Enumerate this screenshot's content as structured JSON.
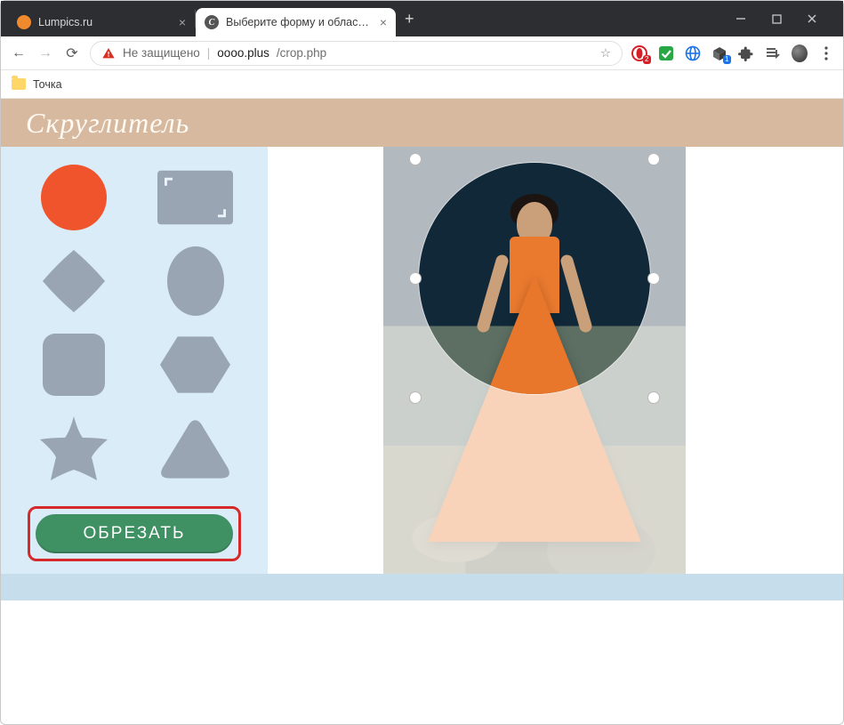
{
  "window": {
    "minimize_icon": "minimize",
    "maximize_icon": "maximize",
    "close_icon": "close"
  },
  "tabs": [
    {
      "title": "Lumpics.ru",
      "active": false
    },
    {
      "title": "Выберите форму и область для",
      "active": true
    }
  ],
  "addressbar": {
    "insecure_label": "Не защищено",
    "host": "oooo.plus",
    "path": "/crop.php"
  },
  "bookmarks": [
    {
      "label": "Точка"
    }
  ],
  "app": {
    "logo": "Скруглитель",
    "crop_button": "ОБРЕЗАТЬ"
  },
  "shapes": [
    {
      "id": "circle",
      "selected": true
    },
    {
      "id": "frame",
      "selected": false
    },
    {
      "id": "diamond",
      "selected": false
    },
    {
      "id": "ellipse",
      "selected": false
    },
    {
      "id": "rounded-square",
      "selected": false
    },
    {
      "id": "hexagon",
      "selected": false
    },
    {
      "id": "star",
      "selected": false
    },
    {
      "id": "triangle",
      "selected": false
    }
  ],
  "colors": {
    "accent": "#f0542d",
    "inactive_shape": "#9aa5b3",
    "panel": "#d9ecf7",
    "header": "#d6b99f",
    "button": "#3f9063",
    "highlight_border": "#d62a2a"
  }
}
